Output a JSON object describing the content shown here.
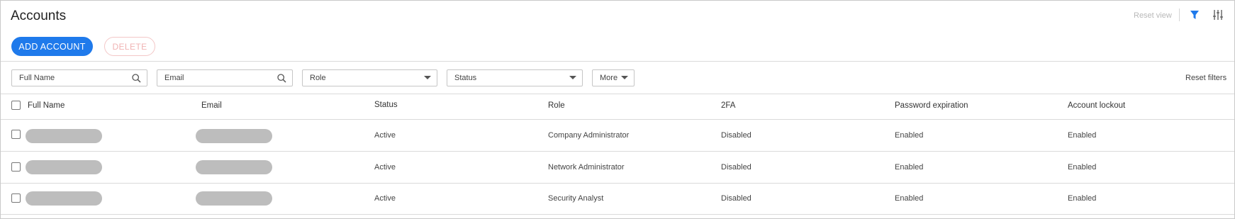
{
  "header": {
    "title": "Accounts",
    "reset_view": "Reset view",
    "filter_icon": "filter-icon",
    "settings_icon": "sliders-icon"
  },
  "toolbar": {
    "add_label": "ADD ACCOUNT",
    "delete_label": "DELETE"
  },
  "filters": {
    "full_name_placeholder": "Full Name",
    "email_placeholder": "Email",
    "role_label": "Role",
    "status_label": "Status",
    "more_label": "More",
    "reset_label": "Reset filters"
  },
  "table": {
    "columns": [
      "Full Name",
      "Email",
      "Status",
      "Role",
      "2FA",
      "Password expiration",
      "Account lockout"
    ],
    "rows": [
      {
        "status": "Active",
        "role": "Company Administrator",
        "tfa": "Disabled",
        "pwd": "Enabled",
        "lockout": "Enabled"
      },
      {
        "status": "Active",
        "role": "Network Administrator",
        "tfa": "Disabled",
        "pwd": "Enabled",
        "lockout": "Enabled"
      },
      {
        "status": "Active",
        "role": "Security Analyst",
        "tfa": "Disabled",
        "pwd": "Enabled",
        "lockout": "Enabled"
      }
    ]
  },
  "colors": {
    "primary": "#1f7aeb",
    "danger_light": "#f0b3b3",
    "redacted": "#bdbdbd"
  }
}
